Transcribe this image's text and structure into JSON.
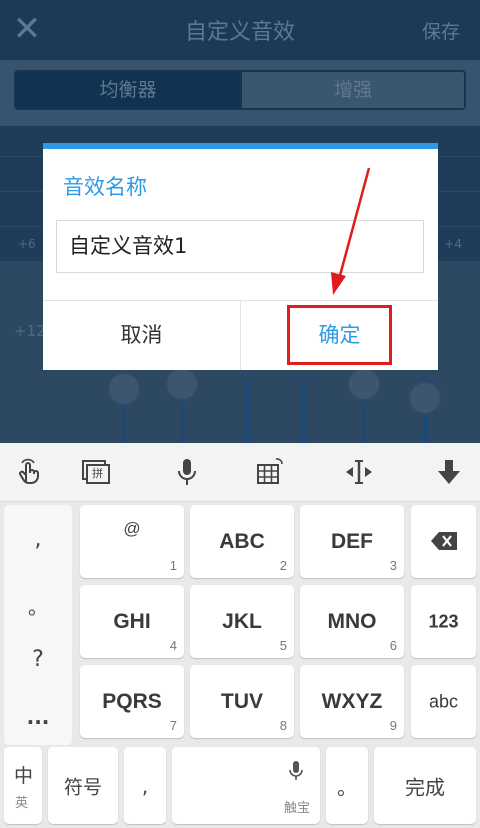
{
  "app": {
    "close_glyph": "✕",
    "title": "自定义音效",
    "save_label": "保存",
    "tabs": [
      "均衡器",
      "增强"
    ],
    "axis_left": "+6",
    "axis_right": "+4",
    "slider_top_label": "+12"
  },
  "dialog": {
    "title": "音效名称",
    "input_value": "自定义音效1",
    "cancel_label": "取消",
    "ok_label": "确定"
  },
  "keyboard": {
    "toolbar_icons": [
      "hand-gesture-icon",
      "pinyin-input-icon",
      "microphone-icon",
      "keyboard-grid-icon",
      "cursor-move-icon",
      "hide-keyboard-icon"
    ],
    "pinyin_icon_text": "拼",
    "punctuation": [
      ",",
      "。",
      "?",
      "..."
    ],
    "keys": [
      {
        "main": "@",
        "num": "1"
      },
      {
        "main": "ABC",
        "num": "2"
      },
      {
        "main": "DEF",
        "num": "3"
      },
      {
        "main": "GHI",
        "num": "4"
      },
      {
        "main": "JKL",
        "num": "5"
      },
      {
        "main": "MNO",
        "num": "6"
      },
      {
        "main": "PQRS",
        "num": "7"
      },
      {
        "main": "TUV",
        "num": "8"
      },
      {
        "main": "WXYZ",
        "num": "9"
      }
    ],
    "side_keys": {
      "num_mode": "123",
      "abc_mode": "abc"
    },
    "bottom": {
      "lang_main": "中",
      "lang_sub": "英",
      "symbols": "符号",
      "comma": ",",
      "space_brand": "触宝",
      "period": "。",
      "done": "完成"
    }
  },
  "colors": {
    "accent": "#2d9be6",
    "annotation": "#e11c1c"
  }
}
